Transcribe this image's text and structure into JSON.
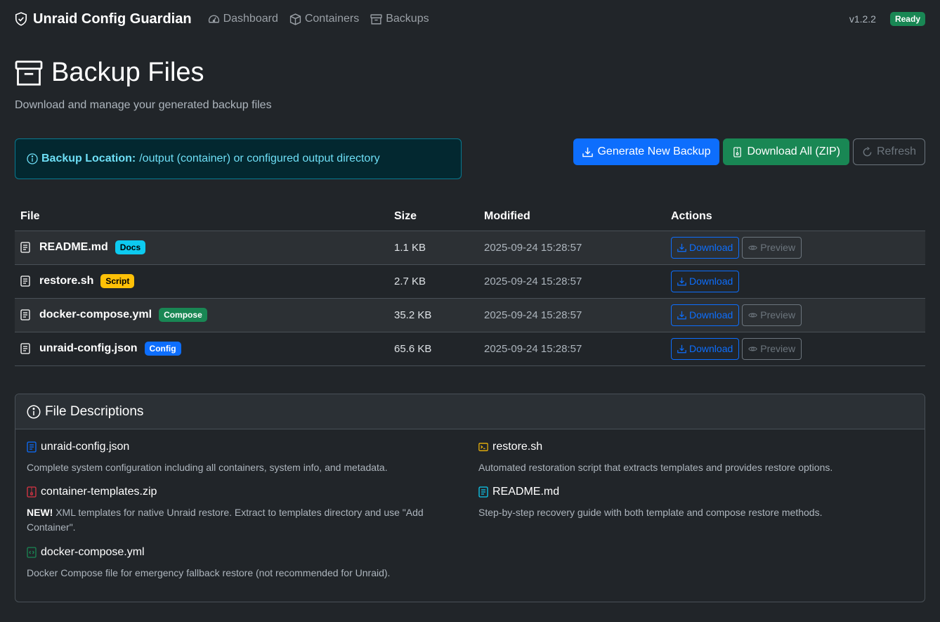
{
  "nav": {
    "brand": "Unraid Config Guardian",
    "links": [
      {
        "label": "Dashboard",
        "icon": "speedometer-icon"
      },
      {
        "label": "Containers",
        "icon": "box-icon"
      },
      {
        "label": "Backups",
        "icon": "archive-icon"
      }
    ],
    "version": "v1.2.2",
    "status": "Ready"
  },
  "header": {
    "title": "Backup Files",
    "subtitle": "Download and manage your generated backup files"
  },
  "alert": {
    "label": "Backup Location:",
    "text": "/output (container) or configured output directory"
  },
  "actions": {
    "generate": "Generate New Backup",
    "download_all": "Download All (ZIP)",
    "refresh": "Refresh"
  },
  "table": {
    "columns": [
      "File",
      "Size",
      "Modified",
      "Actions"
    ],
    "rows": [
      {
        "name": "README.md",
        "badge": "Docs",
        "size": "1.1 KB",
        "modified": "2025-09-24 15:28:57",
        "download": "Download",
        "preview": "Preview"
      },
      {
        "name": "restore.sh",
        "badge": "Script",
        "size": "2.7 KB",
        "modified": "2025-09-24 15:28:57",
        "download": "Download",
        "preview": ""
      },
      {
        "name": "docker-compose.yml",
        "badge": "Compose",
        "size": "35.2 KB",
        "modified": "2025-09-24 15:28:57",
        "download": "Download",
        "preview": "Preview"
      },
      {
        "name": "unraid-config.json",
        "badge": "Config",
        "size": "65.6 KB",
        "modified": "2025-09-24 15:28:57",
        "download": "Download",
        "preview": "Preview"
      }
    ]
  },
  "descriptions": {
    "title": "File Descriptions",
    "items": [
      {
        "name": "unraid-config.json",
        "text": "Complete system configuration including all containers, system info, and metadata.",
        "icon": "file-text-icon",
        "color": "#0d6efd"
      },
      {
        "name": "restore.sh",
        "text": "Automated restoration script that extracts templates and provides restore options.",
        "icon": "terminal-icon",
        "color": "#ffc107"
      },
      {
        "name": "container-templates.zip",
        "new": "NEW!",
        "text": "XML templates for native Unraid restore. Extract to templates directory and use \"Add Container\".",
        "icon": "file-zip-icon",
        "color": "#dc3545"
      },
      {
        "name": "README.md",
        "text": "Step-by-step recovery guide with both template and compose restore methods.",
        "icon": "file-text-icon",
        "color": "#0dcaf0"
      },
      {
        "name": "docker-compose.yml",
        "text": "Docker Compose file for emergency fallback restore (not recommended for Unraid).",
        "icon": "file-code-icon",
        "color": "#198754"
      }
    ]
  }
}
